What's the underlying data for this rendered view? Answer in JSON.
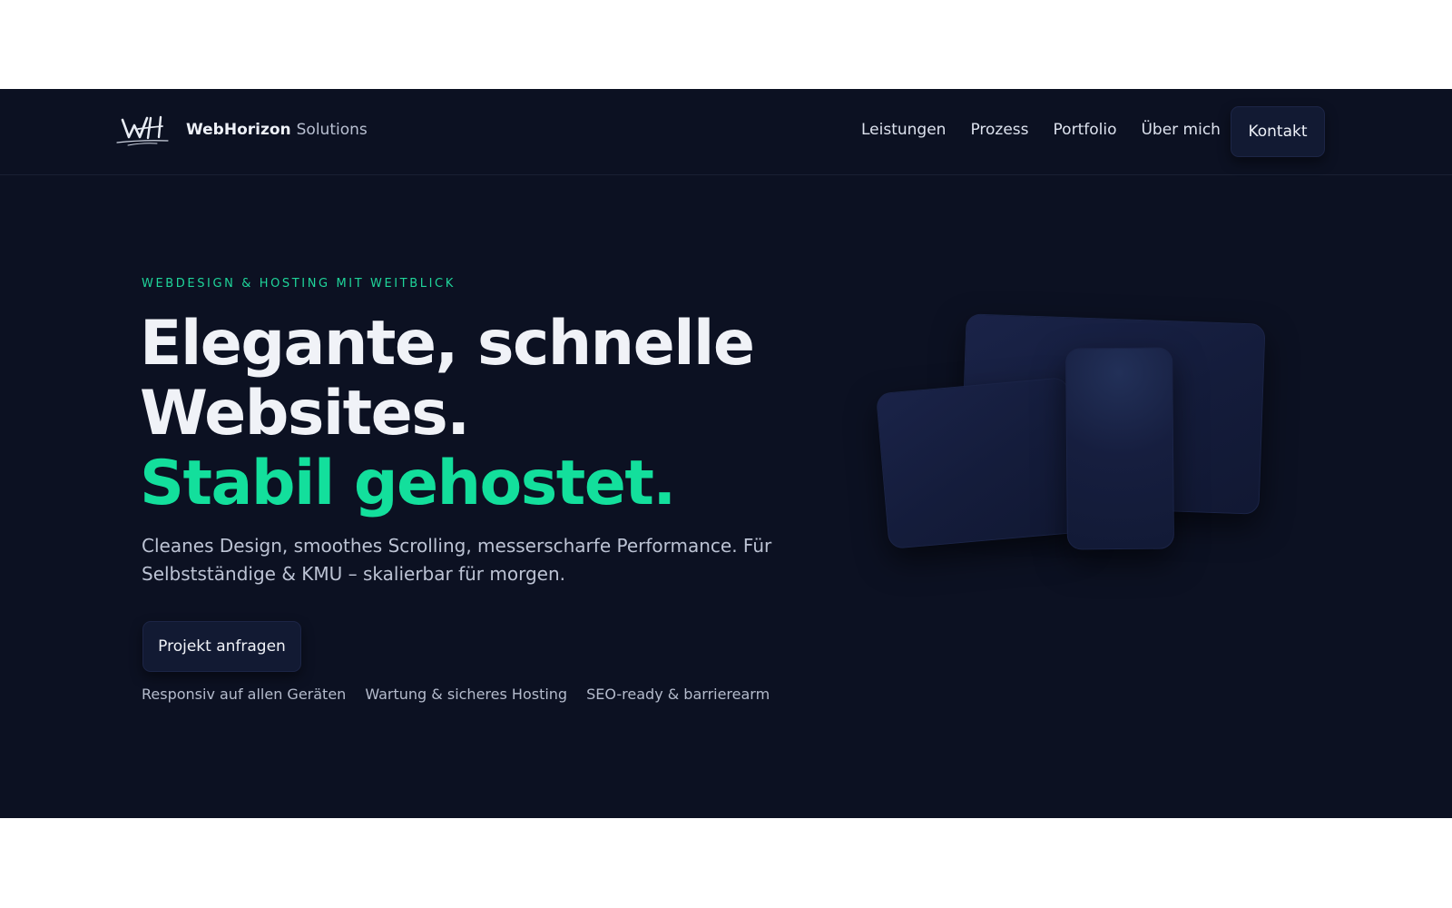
{
  "header": {
    "brand_bold": "WebHorizon",
    "brand_light": "Solutions",
    "nav": [
      "Leistungen",
      "Prozess",
      "Portfolio",
      "Über mich"
    ],
    "contact_label": "Kontakt",
    "logo_icon": "wh-monogram-icon"
  },
  "hero": {
    "eyebrow": "WEBDESIGN & HOSTING MIT WEITBLICK",
    "headline_line1": "Elegante, schnelle",
    "headline_line2": "Websites.",
    "headline_accent": "Stabil gehostet.",
    "lead": "Cleanes Design, smoothes Scrolling, messerscharfe Performance. Für Selbstständige & KMU – skalierbar für morgen.",
    "cta_label": "Projekt anfragen",
    "features": [
      "Responsiv auf allen Geräten",
      "Wartung & sicheres Hosting",
      "SEO-ready & barrierearm"
    ]
  },
  "colors": {
    "background": "#0c1122",
    "accent": "#13df9c",
    "button": "#121a33"
  }
}
